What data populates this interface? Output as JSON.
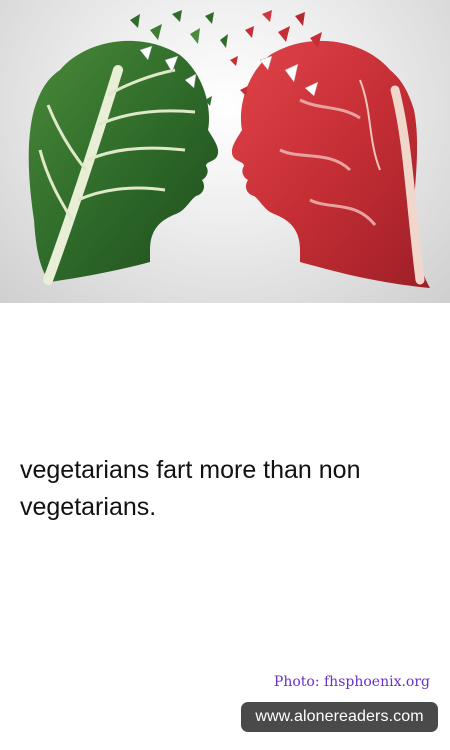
{
  "fact": {
    "text": "vegetarians fart more than non vegetarians."
  },
  "photo_credit": {
    "text": "Photo: fhsphoenix.org"
  },
  "site_badge": {
    "text": "www.alonereaders.com"
  },
  "image": {
    "subject": "leaf-head-and-meat-head-illustration",
    "colors": {
      "leaf": "#2f6b2a",
      "meat": "#c62e35",
      "background": "#d9d9d9"
    }
  }
}
